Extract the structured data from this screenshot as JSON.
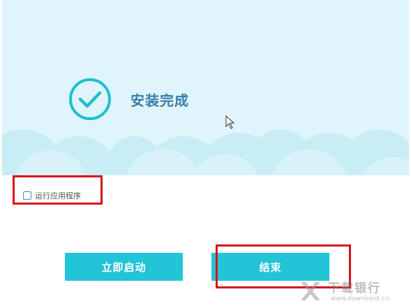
{
  "banner": {
    "title": "安装完成",
    "background_color": "#e0f5fb",
    "cloud_color": "#c6ecf4",
    "icon": "check-circle-icon"
  },
  "options": {
    "run_app_label": "运行应用程序",
    "run_app_checked": false
  },
  "buttons": {
    "launch_label": "立即启动",
    "finish_label": "结束",
    "color": "#22c4d8"
  },
  "highlight_color": "#d7101b",
  "watermark": {
    "name": "下载银行",
    "url": "www.downbank.cn"
  }
}
